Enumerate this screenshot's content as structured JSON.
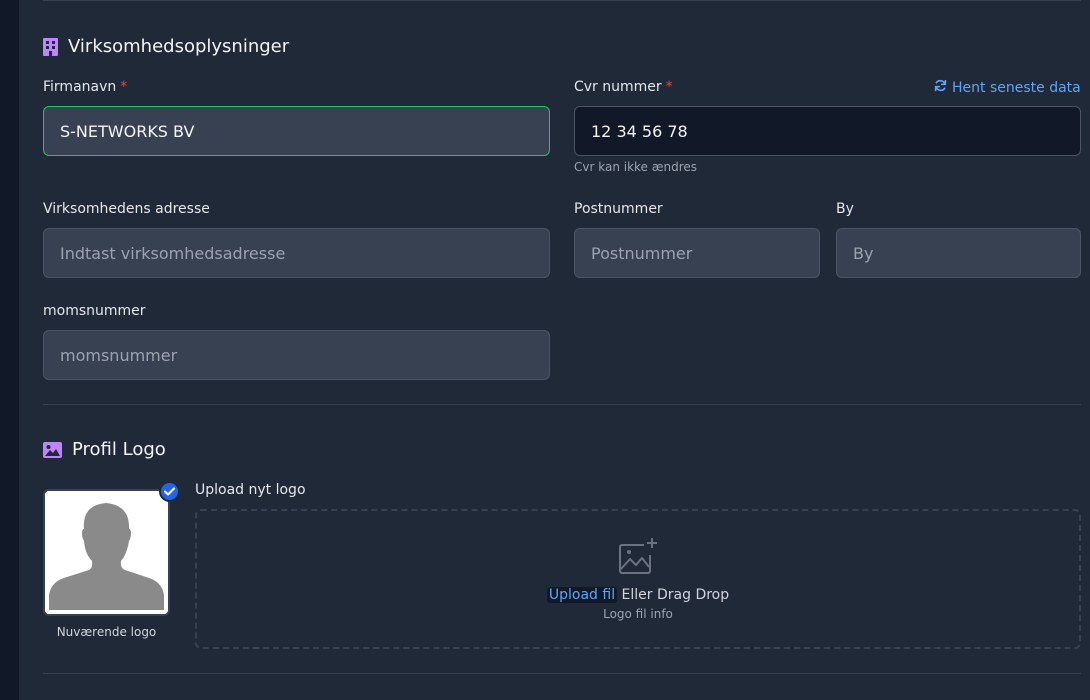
{
  "company_section": {
    "title": "Virksomhedsoplysninger",
    "icon": "building-icon",
    "firmanavn_label": "Firmanavn",
    "firmanavn_value": "S-NETWORKS BV",
    "required_mark": "*",
    "cvr_label": "Cvr nummer",
    "cvr_value": "12 34 56 78",
    "cvr_help": "Cvr kan ikke ændres",
    "fetch_label": "Hent seneste data",
    "address_label": "Virksomhedens adresse",
    "address_placeholder": "Indtast virksomhedsadresse",
    "postal_label": "Postnummer",
    "postal_placeholder": "Postnummer",
    "city_label": "By",
    "city_placeholder": "By",
    "vat_label": "momsnummer",
    "vat_placeholder": "momsnummer"
  },
  "logo_section": {
    "title": "Profil Logo",
    "icon": "image-icon",
    "upload_label": "Upload nyt logo",
    "current_caption": "Nuværende logo",
    "upload_link": "Upload fil",
    "drag_text": "Eller Drag Drop",
    "info": "Logo fil info"
  },
  "colors": {
    "background": "#1f2937",
    "accent": "#60a5fa",
    "icon_purple": "#c084fc",
    "valid_border": "#22c55e",
    "required": "#ef4444",
    "badge": "#2563eb"
  }
}
